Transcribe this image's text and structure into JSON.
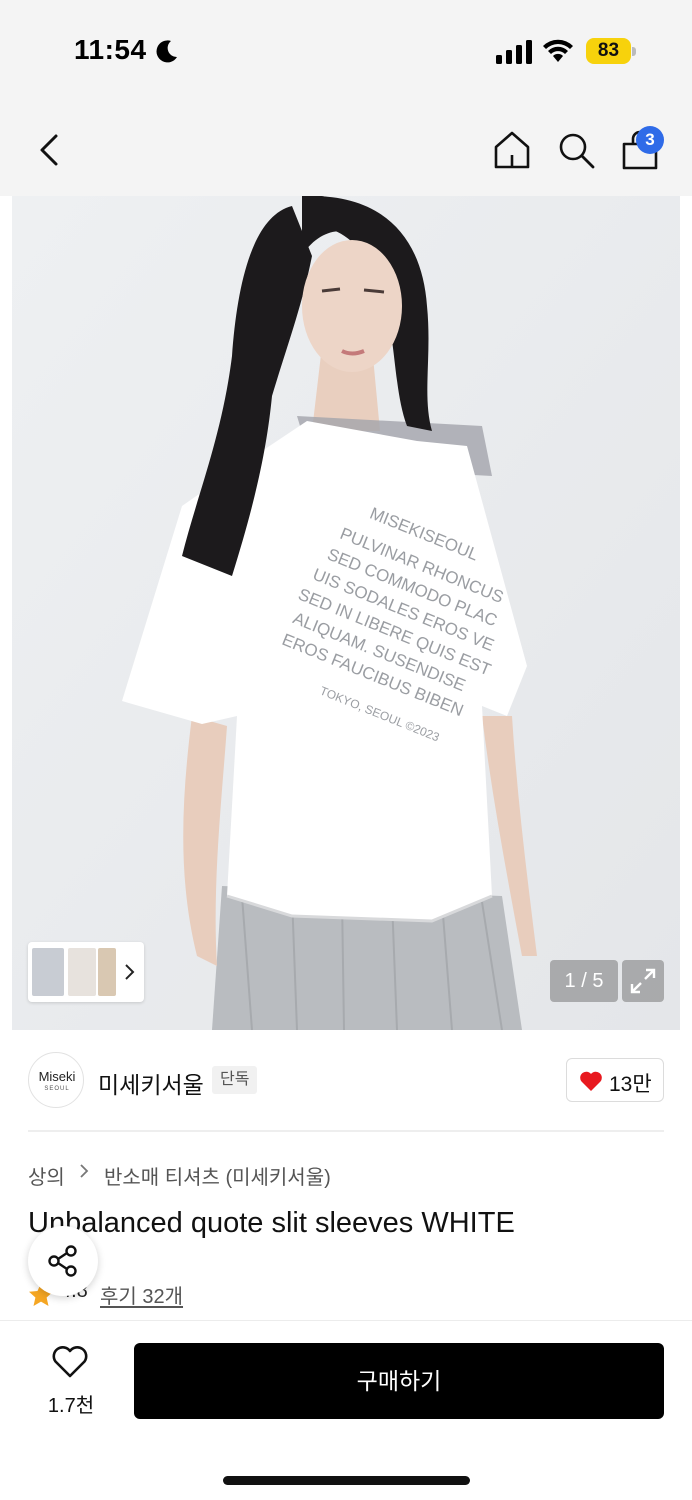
{
  "status_bar": {
    "time": "11:54",
    "battery_percent": "83",
    "icons": [
      "moon-icon",
      "signal-icon",
      "wifi-icon",
      "battery-icon"
    ]
  },
  "nav": {
    "icons": [
      "back-icon",
      "home-icon",
      "search-icon",
      "cart-icon"
    ],
    "cart_count": "3"
  },
  "gallery": {
    "shirt_text": [
      "MISEKISEOUL",
      "PULVINAR RHONCUS",
      "SED COMMODO PLAC",
      "UIS SODALES EROS VE",
      "SED IN LIBERE QUIS EST",
      "ALIQUAM. SUSENDISE",
      "EROS FAUCIBUS BIBEN",
      "TOKYO, SEOUL ©2023"
    ],
    "page_counter": "1 / 5"
  },
  "brand": {
    "logo_text": "Miseki",
    "logo_sub": "SEOUL",
    "name": "미세키서울",
    "badge": "단독",
    "like_count": "13만"
  },
  "product": {
    "breadcrumb": [
      "상의",
      "반소매 티셔츠 (미세키서울)"
    ],
    "title": "Unbalanced quote slit sleeves WHITE",
    "rating": "4.8",
    "reviews": "후기 32개"
  },
  "bottom": {
    "wish_count": "1.7천",
    "buy_label": "구매하기"
  },
  "colors": {
    "accent_badge": "#2f6be8",
    "battery": "#f7d20c",
    "heart": "#e8191f",
    "star": "#f5a623"
  }
}
